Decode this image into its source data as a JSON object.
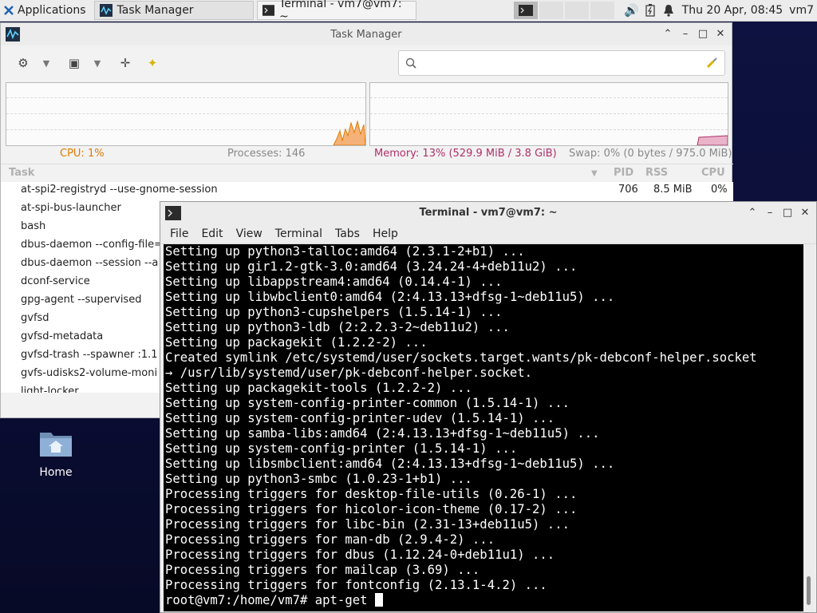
{
  "panel": {
    "applications_label": "Applications",
    "tasks": [
      {
        "label": "Task Manager",
        "icon": "task-manager-icon"
      },
      {
        "label": "Terminal - vm7@vm7: ~",
        "icon": "terminal-icon"
      }
    ],
    "clock": "Thu 20 Apr, 08:45",
    "user": "vm7"
  },
  "task_manager": {
    "title": "Task Manager",
    "search_placeholder": "",
    "cpu": "CPU: 1%",
    "processes": "Processes: 146",
    "memory": "Memory: 13% (529.9 MiB / 3.8 GiB)",
    "swap": "Swap: 0% (0 bytes / 975.0 MiB)",
    "columns": {
      "task": "Task",
      "pid": "PID",
      "rss": "RSS",
      "cpu": "CPU"
    },
    "rows": [
      {
        "name": "at-spi2-registryd --use-gnome-session",
        "pid": "706",
        "rss": "8.5 MiB",
        "cpu": "0%"
      },
      {
        "name": "at-spi-bus-launcher"
      },
      {
        "name": "bash"
      },
      {
        "name": "dbus-daemon --config-file="
      },
      {
        "name": "dbus-daemon --session --a"
      },
      {
        "name": "dconf-service"
      },
      {
        "name": "gpg-agent --supervised"
      },
      {
        "name": "gvfsd"
      },
      {
        "name": "gvfsd-metadata"
      },
      {
        "name": "gvfsd-trash --spawner :1.1"
      },
      {
        "name": "gvfs-udisks2-volume-moni"
      },
      {
        "name": "light-locker"
      }
    ],
    "colors": {
      "cpu": "#e07b00",
      "memory": "#b0306a"
    }
  },
  "terminal": {
    "title": "Terminal - vm7@vm7: ~",
    "menu": [
      "File",
      "Edit",
      "View",
      "Terminal",
      "Tabs",
      "Help"
    ],
    "lines": [
      "Setting up python3-talloc:amd64 (2.3.1-2+b1) ...",
      "Setting up gir1.2-gtk-3.0:amd64 (3.24.24-4+deb11u2) ...",
      "Setting up libappstream4:amd64 (0.14.4-1) ...",
      "Setting up libwbclient0:amd64 (2:4.13.13+dfsg-1~deb11u5) ...",
      "Setting up python3-cupshelpers (1.5.14-1) ...",
      "Setting up python3-ldb (2:2.2.3-2~deb11u2) ...",
      "Setting up packagekit (1.2.2-2) ...",
      "Created symlink /etc/systemd/user/sockets.target.wants/pk-debconf-helper.socket",
      "→ /usr/lib/systemd/user/pk-debconf-helper.socket.",
      "Setting up packagekit-tools (1.2.2-2) ...",
      "Setting up system-config-printer-common (1.5.14-1) ...",
      "Setting up system-config-printer-udev (1.5.14-1) ...",
      "Setting up samba-libs:amd64 (2:4.13.13+dfsg-1~deb11u5) ...",
      "Setting up system-config-printer (1.5.14-1) ...",
      "Setting up libsmbclient:amd64 (2:4.13.13+dfsg-1~deb11u5) ...",
      "Setting up python3-smbc (1.0.23-1+b1) ...",
      "Processing triggers for desktop-file-utils (0.26-1) ...",
      "Processing triggers for hicolor-icon-theme (0.17-2) ...",
      "Processing triggers for libc-bin (2.31-13+deb11u5) ...",
      "Processing triggers for man-db (2.9.4-2) ...",
      "Processing triggers for dbus (1.12.24-0+deb11u1) ...",
      "Processing triggers for mailcap (3.69) ...",
      "Processing triggers for fontconfig (2.13.1-4.2) ..."
    ],
    "prompt": "root@vm7:/home/vm7# apt-get "
  },
  "desktop": {
    "home_label": "Home"
  }
}
